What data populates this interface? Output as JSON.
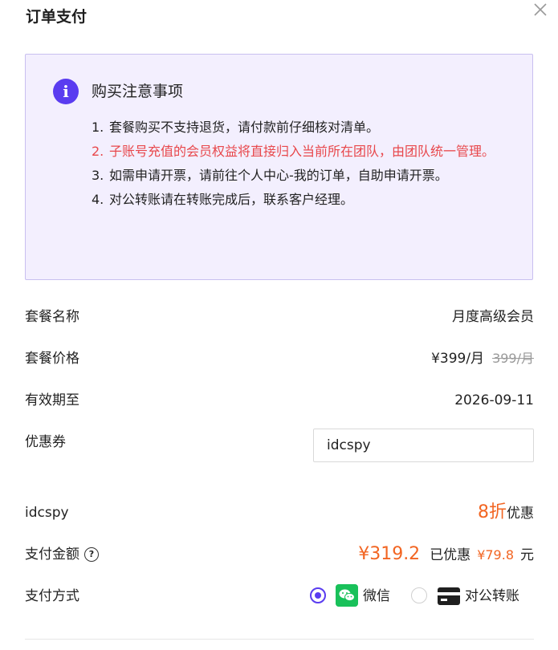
{
  "header": {
    "title": "订单支付"
  },
  "notice": {
    "title": "购买注意事项",
    "items": [
      {
        "num": "1.",
        "text": "套餐购买不支持退货，请付款前仔细核对清单。"
      },
      {
        "num": "2.",
        "text": "子账号充值的会员权益将直接归入当前所在团队，由团队统一管理。"
      },
      {
        "num": "3.",
        "text": "如需申请开票，请前往个人中心-我的订单，自助申请开票。"
      },
      {
        "num": "4.",
        "text": "对公转账请在转账完成后，联系客户经理。"
      }
    ]
  },
  "details": {
    "package_name_label": "套餐名称",
    "package_name_value": "月度高级会员",
    "package_price_label": "套餐价格",
    "package_price_value": "¥399/月",
    "package_price_original": "399/月",
    "valid_until_label": "有效期至",
    "valid_until_value": "2026-09-11",
    "coupon_label": "优惠券",
    "coupon_value": "idcspy"
  },
  "discount": {
    "code": "idcspy",
    "rate": "8折",
    "suffix": "优惠"
  },
  "payment": {
    "amount_label": "支付金额",
    "amount": "¥319.2",
    "saved_label": "已优惠",
    "saved_amount": "¥79.8",
    "unit": "元",
    "method_label": "支付方式",
    "methods": [
      {
        "label": "微信",
        "selected": true
      },
      {
        "label": "对公转账",
        "selected": false
      }
    ]
  },
  "colors": {
    "accent": "#5a3cf0",
    "price": "#f26522",
    "warning": "#e8474b",
    "notice_bg": "#f3effe",
    "wechat": "#19c15a"
  }
}
